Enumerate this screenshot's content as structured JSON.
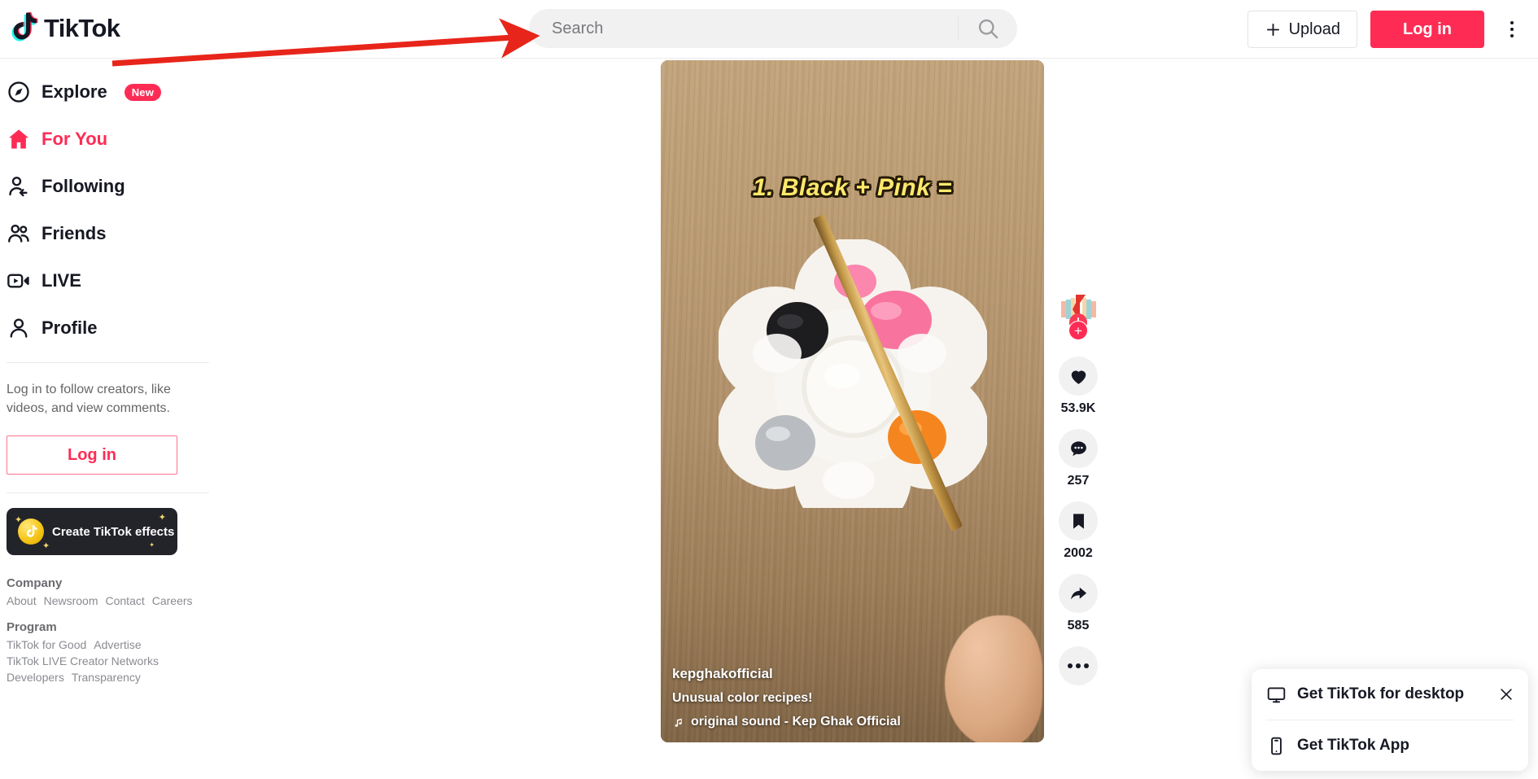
{
  "header": {
    "logo_text": "TikTok",
    "logo_icon": "tiktok-note-icon",
    "search": {
      "placeholder": "Search",
      "value": "",
      "icon": "search-icon"
    },
    "upload_label": "Upload",
    "upload_icon": "plus-icon",
    "login_label": "Log in",
    "more_icon": "kebab-vertical-icon"
  },
  "sidebar": {
    "nav": [
      {
        "label": "Explore",
        "icon": "compass-icon",
        "badge": "New",
        "active": false
      },
      {
        "label": "For You",
        "icon": "home-icon",
        "badge": "",
        "active": true
      },
      {
        "label": "Following",
        "icon": "user-follow-icon",
        "badge": "",
        "active": false
      },
      {
        "label": "Friends",
        "icon": "users-icon",
        "badge": "",
        "active": false
      },
      {
        "label": "LIVE",
        "icon": "live-video-icon",
        "badge": "",
        "active": false
      },
      {
        "label": "Profile",
        "icon": "person-icon",
        "badge": "",
        "active": false
      }
    ],
    "login_prompt": "Log in to follow creators, like videos, and view comments.",
    "login_label": "Log in",
    "effects_banner": {
      "label": "Create TikTok effects",
      "icon": "tiktok-coin-icon"
    },
    "footer": [
      {
        "heading": "Company",
        "links": [
          "About",
          "Newsroom",
          "Contact",
          "Careers"
        ]
      },
      {
        "heading": "Program",
        "links": [
          "TikTok for Good",
          "Advertise",
          "TikTok LIVE Creator Networks",
          "Developers",
          "Transparency"
        ]
      }
    ]
  },
  "video": {
    "overlay_text": "1. Black + Pink =",
    "username": "kepghakofficial",
    "description": "Unusual color recipes!",
    "music_icon": "music-note-icon",
    "music": "original sound - Kep Ghak Official"
  },
  "actions": {
    "avatar_name": "avatar",
    "follow_icon": "plus-icon",
    "items": [
      {
        "icon": "heart-icon",
        "count": "53.9K",
        "name": "like-button"
      },
      {
        "icon": "comment-icon",
        "count": "257",
        "name": "comment-button"
      },
      {
        "icon": "bookmark-icon",
        "count": "2002",
        "name": "bookmark-button"
      },
      {
        "icon": "share-icon",
        "count": "585",
        "name": "share-button"
      }
    ],
    "more_icon": "dots-horizontal-icon"
  },
  "popup": {
    "desktop_label": "Get TikTok for desktop",
    "desktop_icon": "monitor-icon",
    "app_label": "Get TikTok App",
    "app_icon": "phone-icon",
    "close_icon": "close-icon"
  },
  "colors": {
    "brand_red": "#fe2c55",
    "brand_cyan": "#25f4ee",
    "text": "#161823",
    "muted": "#8a8b91",
    "chip_bg": "#f1f1f2",
    "annotation_red": "#e8251a"
  }
}
